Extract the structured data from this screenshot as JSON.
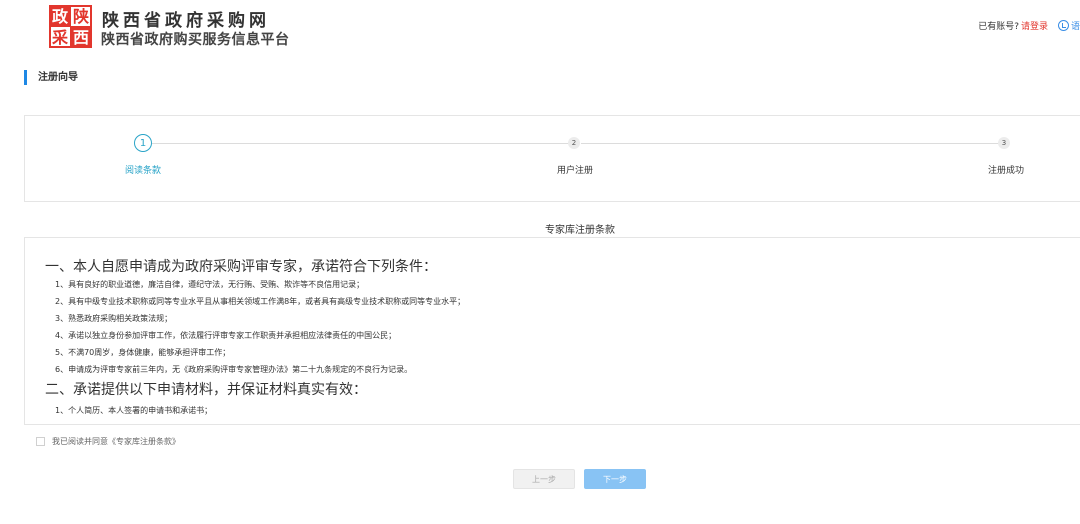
{
  "header": {
    "site_title": "陕西省政府采购网",
    "site_subtitle": "陕西省政府购买服务信息平台",
    "logo_text_top": "政陕",
    "logo_text_bottom": "采西",
    "account_prompt": "已有账号?",
    "login_link": "请登录",
    "cutoff_text": "语"
  },
  "section": {
    "title": "注册向导"
  },
  "steps": [
    {
      "number": "1",
      "label": "阅读条款",
      "active": true
    },
    {
      "number": "2",
      "label": "用户注册",
      "active": false
    },
    {
      "number": "3",
      "label": "注册成功",
      "active": false
    }
  ],
  "terms": {
    "title": "专家库注册条款",
    "heading1": "一、本人自愿申请成为政府采购评审专家，承诺符合下列条件：",
    "items1": [
      "1、具有良好的职业道德，廉洁自律，遵纪守法，无行贿、受贿、欺诈等不良信用记录；",
      "2、具有中级专业技术职称或同等专业水平且从事相关领域工作满8年，或者具有高级专业技术职称或同等专业水平；",
      "3、熟悉政府采购相关政策法规；",
      "4、承诺以独立身份参加评审工作，依法履行评审专家工作职责并承担相应法律责任的中国公民；",
      "5、不满70周岁，身体健康，能够承担评审工作；",
      "6、申请成为评审专家前三年内，无《政府采购评审专家管理办法》第二十九条规定的不良行为记录。"
    ],
    "heading2": "二、承诺提供以下申请材料，并保证材料真实有效：",
    "items2": [
      "1、个人简历、本人签署的申请书和承诺书；"
    ]
  },
  "agree": {
    "label": "我已阅读并同意《专家库注册条款》",
    "checked": false
  },
  "buttons": {
    "prev": "上一步",
    "next": "下一步"
  },
  "colors": {
    "accent": "#2aa4c8",
    "section_bar": "#1e88e5",
    "logo_red": "#e2362d",
    "next_button": "#88c3f4"
  },
  "icons": {
    "logo": "gov-procurement-logo",
    "lang": "language-icon"
  }
}
